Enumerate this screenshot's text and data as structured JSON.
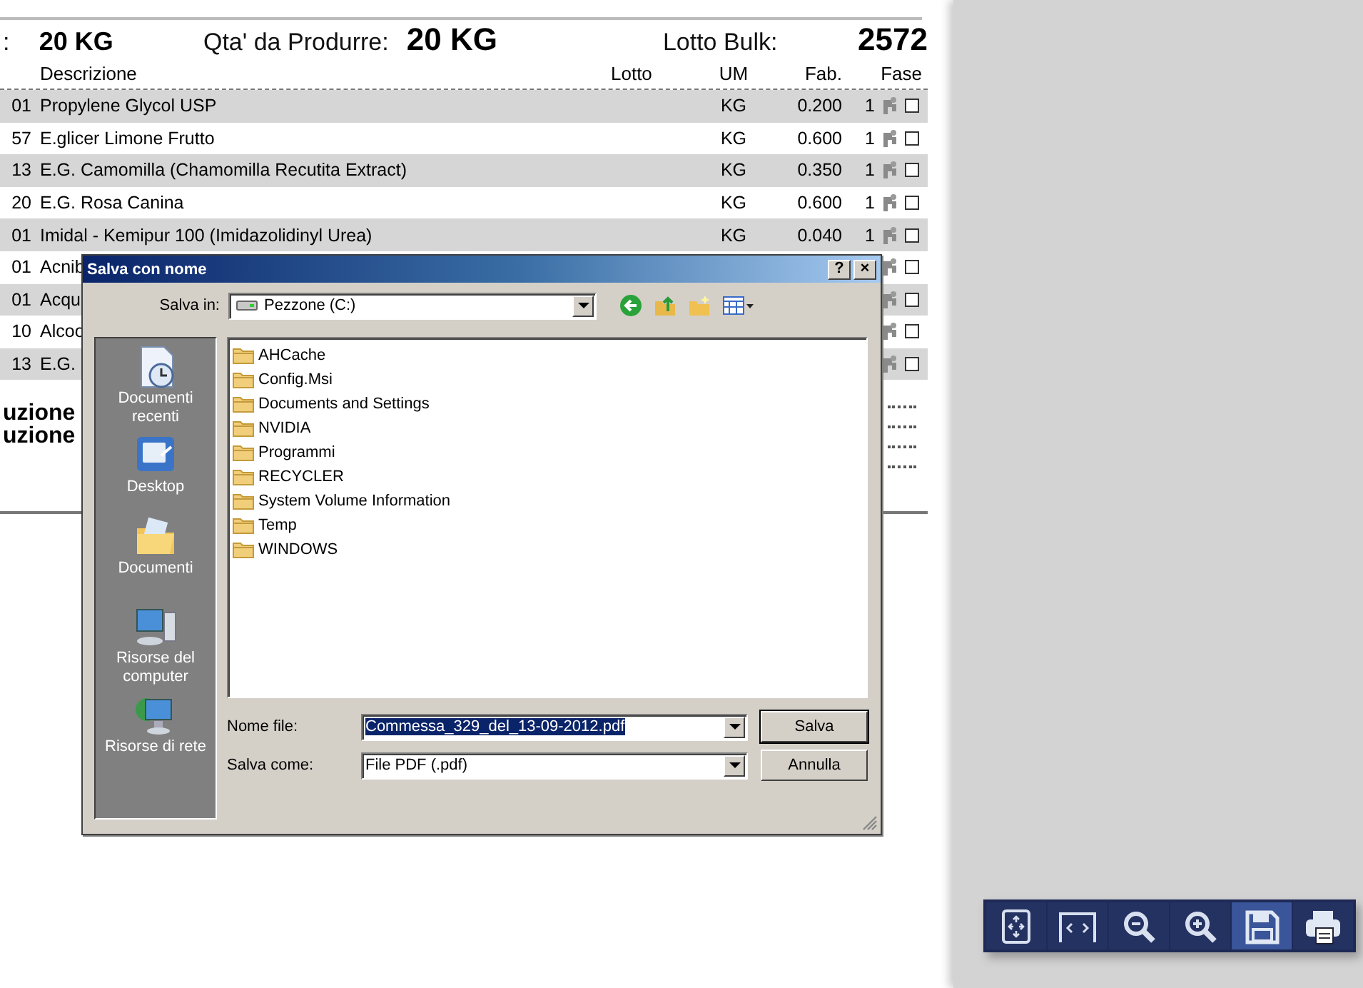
{
  "summary": {
    "left_label": ":",
    "left_value": "20 KG",
    "qty_label": "Qta' da Produrre:",
    "qty_value": "20 KG",
    "batch_label": "Lotto Bulk:",
    "batch_value": "2572"
  },
  "table": {
    "columns": [
      "Descrizione",
      "Lotto",
      "UM",
      "Fab.",
      "Fase"
    ],
    "rows": [
      {
        "code": "01",
        "description": "Propylene Glycol USP",
        "um": "KG",
        "fab": "0.200",
        "phase": "1",
        "checked": false
      },
      {
        "code": "57",
        "description": "E.glicer Limone Frutto",
        "um": "KG",
        "fab": "0.600",
        "phase": "1",
        "checked": false
      },
      {
        "code": "13",
        "description": "E.G. Camomilla (Chamomilla Recutita Extract)",
        "um": "KG",
        "fab": "0.350",
        "phase": "1",
        "checked": false
      },
      {
        "code": "20",
        "description": "E.G. Rosa Canina",
        "um": "KG",
        "fab": "0.600",
        "phase": "1",
        "checked": false
      },
      {
        "code": "01",
        "description": "Imidal - Kemipur 100 (Imidazolidinyl Urea)",
        "um": "KG",
        "fab": "0.040",
        "phase": "1",
        "checked": false
      },
      {
        "code": "01",
        "description": "Acnib",
        "checked": false
      },
      {
        "code": "01",
        "description": "Acqu",
        "checked": false
      },
      {
        "code": "10",
        "description": "Alcoo",
        "checked": false
      },
      {
        "code": "13",
        "description": "E.G.",
        "checked": false
      }
    ]
  },
  "notes": [
    "uzione",
    "uzione"
  ],
  "dialog": {
    "title": "Salva con nome",
    "help": "?",
    "close": "×",
    "location_label": "Salva in:",
    "location": "Pezzone (C:)",
    "places": [
      {
        "kind": "recent",
        "label": "Documenti recenti"
      },
      {
        "kind": "desktop",
        "label": "Desktop"
      },
      {
        "kind": "documents",
        "label": "Documenti"
      },
      {
        "kind": "computer",
        "label": "Risorse del computer"
      },
      {
        "kind": "network",
        "label": "Risorse di rete"
      }
    ],
    "folders": [
      "AHCache",
      "Config.Msi",
      "Documents and Settings",
      "NVIDIA",
      "Programmi",
      "RECYCLER",
      "System Volume Information",
      "Temp",
      "WINDOWS"
    ],
    "filename_label": "Nome file:",
    "filename": "Commessa_329_del_13-09-2012.pdf",
    "filename_selected": true,
    "type_label": "Salva come:",
    "type": "File PDF (.pdf)",
    "buttons": [
      "Salva",
      "Annulla"
    ]
  },
  "viewer_toolbar": [
    {
      "kind": "fit",
      "selected": false
    },
    {
      "kind": "width",
      "selected": false
    },
    {
      "kind": "zoom-out",
      "selected": false
    },
    {
      "kind": "zoom-in",
      "selected": false
    },
    {
      "kind": "save",
      "selected": true
    },
    {
      "kind": "print",
      "selected": false
    }
  ]
}
